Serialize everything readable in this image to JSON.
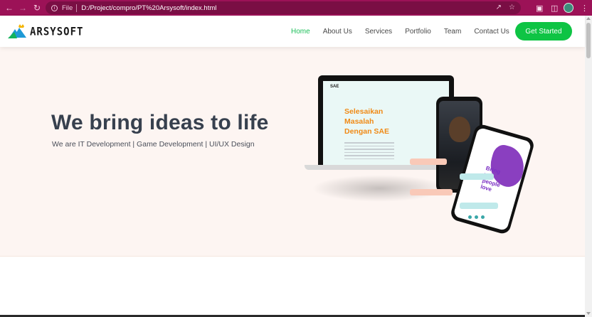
{
  "browser": {
    "back_icon": "back-arrow-icon",
    "forward_icon": "forward-arrow-icon",
    "reload_icon": "reload-icon",
    "file_label": "File",
    "url": "D:/Project/compro/PT%20Arsysoft/index.html",
    "theme_color": "#9c1257"
  },
  "header": {
    "logo_text": "ARSYSOFT",
    "nav": [
      {
        "label": "Home",
        "active": true
      },
      {
        "label": "About Us",
        "active": false
      },
      {
        "label": "Services",
        "active": false
      },
      {
        "label": "Portfolio",
        "active": false
      },
      {
        "label": "Team",
        "active": false
      },
      {
        "label": "Contact Us",
        "active": false
      }
    ],
    "cta_label": "Get Started",
    "accent_color": "#0ec444"
  },
  "hero": {
    "title": "We bring ideas to life",
    "subtitle": "We are IT Development | Game Development | UI/UX Design",
    "background": "#fdf5f2"
  },
  "illustration": {
    "laptop_brand": "SAE",
    "laptop_heading_1": "Selesaikan",
    "laptop_heading_2": "Masalah",
    "laptop_heading_3": "Dengan SAE",
    "phone_text_1": "Bring",
    "phone_text_2": "you",
    "phone_text_3": "people",
    "phone_text_4": "love"
  }
}
